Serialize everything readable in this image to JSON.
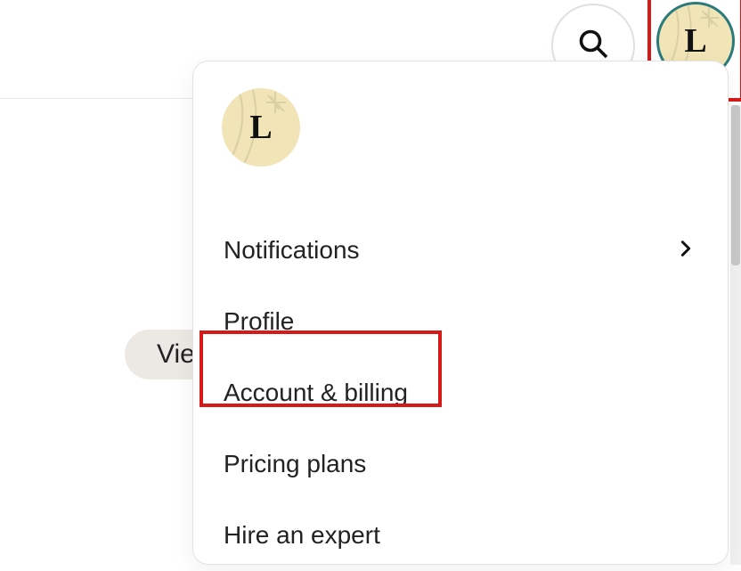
{
  "header": {
    "avatar_letter": "L"
  },
  "button_bg_label": "Vie",
  "menu": {
    "avatar_letter": "L",
    "items": [
      {
        "label": "Notifications",
        "has_chevron": true
      },
      {
        "label": "Profile",
        "has_chevron": false
      },
      {
        "label": "Account & billing",
        "has_chevron": false
      },
      {
        "label": "Pricing plans",
        "has_chevron": false
      },
      {
        "label": "Hire an expert",
        "has_chevron": false
      }
    ]
  }
}
